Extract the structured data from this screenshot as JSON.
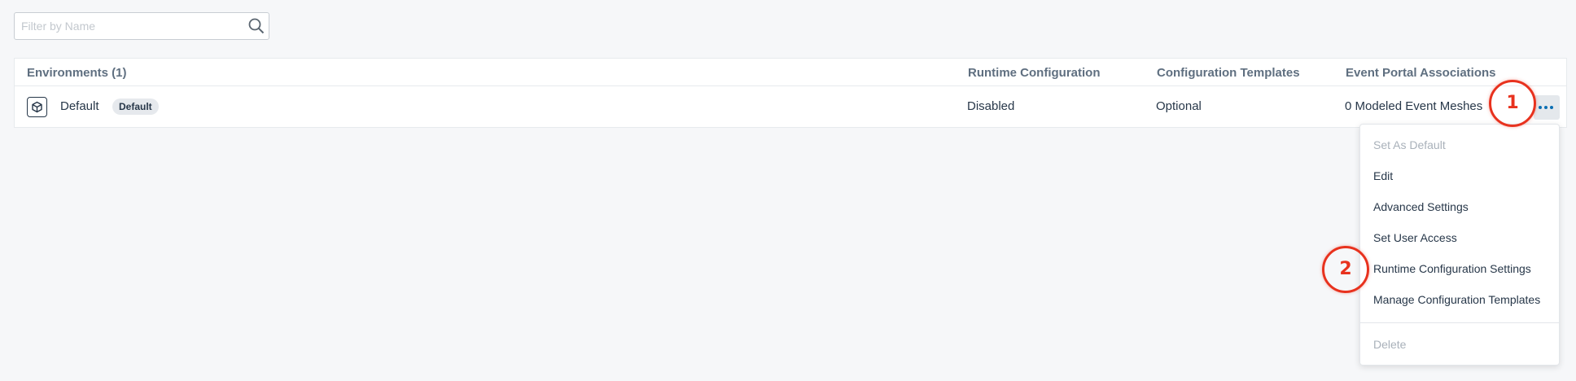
{
  "search": {
    "placeholder": "Filter by Name",
    "value": ""
  },
  "table": {
    "columns": {
      "name": "Environments (1)",
      "runtime": "Runtime Configuration",
      "templates": "Configuration Templates",
      "portal": "Event Portal Associations"
    },
    "rows": [
      {
        "name": "Default",
        "badge": "Default",
        "runtime": "Disabled",
        "templates": "Optional",
        "portal": "0 Modeled Event Meshes"
      }
    ]
  },
  "menu": {
    "items": [
      {
        "label": "Set As Default",
        "disabled": true
      },
      {
        "label": "Edit",
        "disabled": false
      },
      {
        "label": "Advanced Settings",
        "disabled": false
      },
      {
        "label": "Set User Access",
        "disabled": false
      },
      {
        "label": "Runtime Configuration Settings",
        "disabled": false
      },
      {
        "label": "Manage Configuration Templates",
        "disabled": false
      },
      {
        "label": "Delete",
        "disabled": true
      }
    ]
  },
  "annotations": {
    "marker_1": "1",
    "marker_2": "2"
  },
  "colors": {
    "accent": "#0b6fb3",
    "marker": "#e8321e",
    "disabled_text": "#a9b1ba"
  }
}
